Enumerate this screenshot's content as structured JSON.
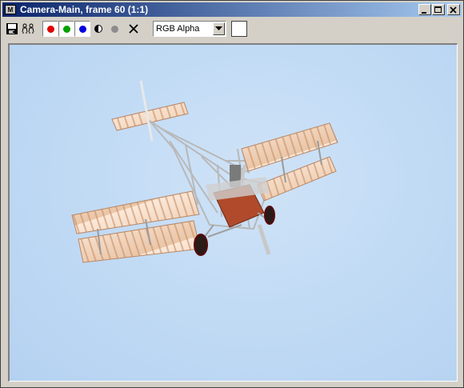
{
  "window": {
    "title": "Camera-Main, frame 60 (1:1)",
    "icon_glyph": "M"
  },
  "toolbar": {
    "channel_select": "RGB Alpha",
    "icons": [
      "save-icon",
      "clone-icon",
      "red-channel-icon",
      "green-channel-icon",
      "blue-channel-icon",
      "monochrome-icon",
      "alpha-channel-icon",
      "clear-icon"
    ]
  },
  "colors": {
    "titlebar_start": "#0a246a",
    "titlebar_end": "#a6caf0",
    "red_channel": "#e00000",
    "green_channel": "#00a000",
    "blue_channel": "#0000e0",
    "sky": "#c2dbf5"
  }
}
